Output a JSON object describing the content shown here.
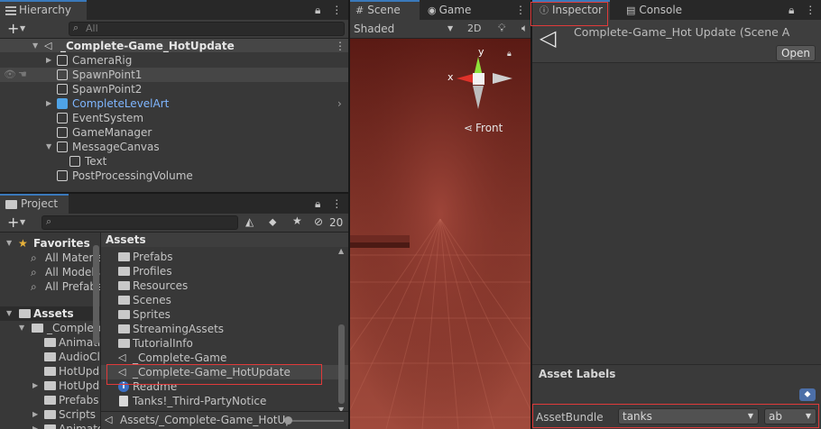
{
  "hierarchy": {
    "tab_label": "Hierarchy",
    "search_placeholder": "All",
    "scene_name": "_Complete-Game_HotUpdate",
    "items": [
      {
        "label": "CameraRig"
      },
      {
        "label": "SpawnPoint1"
      },
      {
        "label": "SpawnPoint2"
      },
      {
        "label": "CompleteLevelArt"
      },
      {
        "label": "EventSystem"
      },
      {
        "label": "GameManager"
      },
      {
        "label": "MessageCanvas"
      },
      {
        "label": "Text"
      },
      {
        "label": "PostProcessingVolume"
      }
    ]
  },
  "scene_view": {
    "tab_scene": "Scene",
    "tab_game": "Game",
    "shading_mode": "Shaded",
    "toggle_2d": "2D",
    "gizmo_x": "x",
    "gizmo_y": "y",
    "view_label": "Front"
  },
  "project": {
    "tab_label": "Project",
    "hidden_count": "20",
    "favorites": {
      "label": "Favorites",
      "items": [
        {
          "label": "All Materials"
        },
        {
          "label": "All Models"
        },
        {
          "label": "All Prefabs"
        }
      ]
    },
    "assets_tree": {
      "label": "Assets",
      "items": [
        {
          "label": "_Complete-Game"
        },
        {
          "label": "Animation"
        },
        {
          "label": "AudioClips"
        },
        {
          "label": "HotUpdate"
        },
        {
          "label": "HotUpdate"
        },
        {
          "label": "Prefabs"
        },
        {
          "label": "Scripts"
        },
        {
          "label": "Animator"
        }
      ]
    },
    "assets_header": "Assets",
    "asset_items": [
      {
        "label": "Prefabs"
      },
      {
        "label": "Profiles"
      },
      {
        "label": "Resources"
      },
      {
        "label": "Scenes"
      },
      {
        "label": "Sprites"
      },
      {
        "label": "StreamingAssets"
      },
      {
        "label": "TutorialInfo"
      },
      {
        "label": "_Complete-Game"
      },
      {
        "label": "_Complete-Game_HotUpdate"
      },
      {
        "label": "Readme"
      },
      {
        "label": "Tanks!_Third-PartyNotice"
      }
    ],
    "path_text": "Assets/_Complete-Game_HotUp"
  },
  "inspector": {
    "tab_inspector": "Inspector",
    "tab_console": "Console",
    "asset_title": "Complete-Game_Hot Update (Scene A",
    "open_button": "Open",
    "asset_labels": "Asset Labels",
    "asset_bundle_label": "AssetBundle",
    "asset_bundle_value": "tanks",
    "asset_bundle_variant": "ab"
  },
  "colors": {
    "accent": "#3a79bb",
    "highlight_box": "#e03a3a",
    "prefab_blue": "#7fb6ff",
    "scene_bg": "#5c1d16"
  }
}
